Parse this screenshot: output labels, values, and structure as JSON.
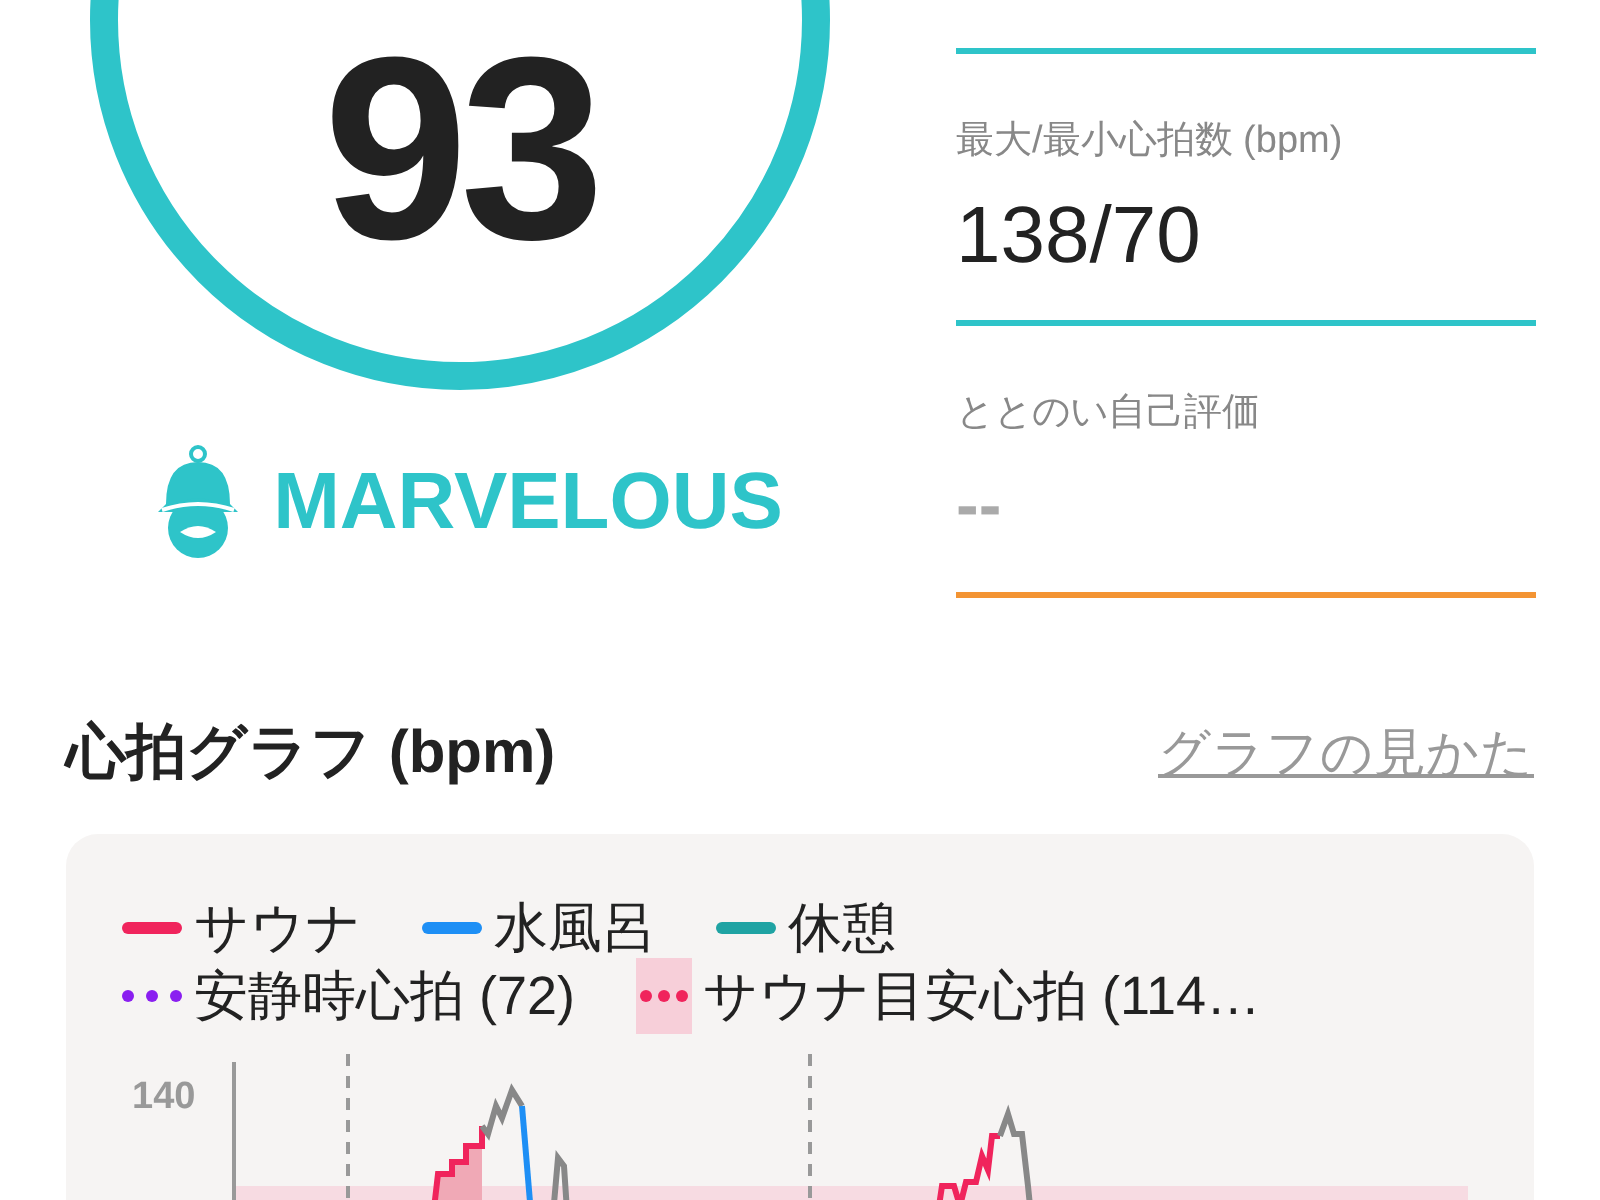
{
  "score": {
    "value": "93",
    "rank": "MARVELOUS"
  },
  "stats": [
    {
      "color": "#2ec4c9"
    },
    {
      "label": "最大/最小心拍数 (bpm)",
      "value": "138/70",
      "color": "#2ec4c9"
    },
    {
      "label": "ととのい自己評価",
      "value": "--",
      "empty": true,
      "color": "#f39433"
    }
  ],
  "heart_graph": {
    "title": "心拍グラフ (bpm)",
    "help_link": "グラフの見かた",
    "legend": [
      {
        "label": "サウナ",
        "kind": "line",
        "color": "#f0245c"
      },
      {
        "label": "水風呂",
        "kind": "line",
        "color": "#1e8ff5"
      },
      {
        "label": "休憩",
        "kind": "line",
        "color": "#1fa3a3"
      },
      {
        "label": "安静時心拍 (72)",
        "kind": "dots",
        "color": "#8a1ff0"
      },
      {
        "label": "サウナ目安心拍 (114…",
        "kind": "band",
        "color": "#f0245c"
      }
    ],
    "y_tick": "140"
  }
}
